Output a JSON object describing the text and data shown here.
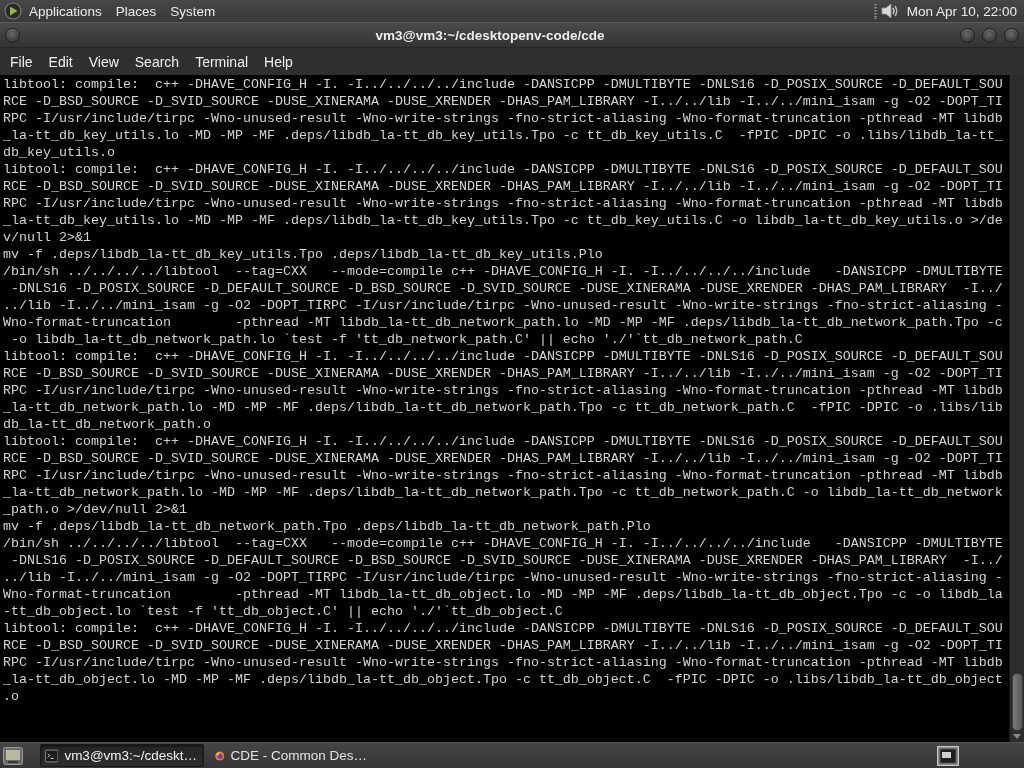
{
  "top_panel": {
    "menus": [
      "Applications",
      "Places",
      "System"
    ],
    "clock": "Mon Apr 10, 22:00"
  },
  "window": {
    "title": "vm3@vm3:~/cdesktopenv-code/cde",
    "menu": [
      "File",
      "Edit",
      "View",
      "Search",
      "Terminal",
      "Help"
    ]
  },
  "terminal": {
    "lines": [
      "libtool: compile:  c++ -DHAVE_CONFIG_H -I. -I../../../../include -DANSICPP -DMULTIBYTE -DNLS16 -D_POSIX_SOURCE -D_DEFAULT_SOU",
      "RCE -D_BSD_SOURCE -D_SVID_SOURCE -DUSE_XINERAMA -DUSE_XRENDER -DHAS_PAM_LIBRARY -I../../lib -I../../mini_isam -g -O2 -DOPT_TI",
      "RPC -I/usr/include/tirpc -Wno-unused-result -Wno-write-strings -fno-strict-aliasing -Wno-format-truncation -pthread -MT libdb",
      "_la-tt_db_key_utils.lo -MD -MP -MF .deps/libdb_la-tt_db_key_utils.Tpo -c tt_db_key_utils.C  -fPIC -DPIC -o .libs/libdb_la-tt_",
      "db_key_utils.o",
      "libtool: compile:  c++ -DHAVE_CONFIG_H -I. -I../../../../include -DANSICPP -DMULTIBYTE -DNLS16 -D_POSIX_SOURCE -D_DEFAULT_SOU",
      "RCE -D_BSD_SOURCE -D_SVID_SOURCE -DUSE_XINERAMA -DUSE_XRENDER -DHAS_PAM_LIBRARY -I../../lib -I../../mini_isam -g -O2 -DOPT_TI",
      "RPC -I/usr/include/tirpc -Wno-unused-result -Wno-write-strings -fno-strict-aliasing -Wno-format-truncation -pthread -MT libdb",
      "_la-tt_db_key_utils.lo -MD -MP -MF .deps/libdb_la-tt_db_key_utils.Tpo -c tt_db_key_utils.C -o libdb_la-tt_db_key_utils.o >/de",
      "v/null 2>&1",
      "mv -f .deps/libdb_la-tt_db_key_utils.Tpo .deps/libdb_la-tt_db_key_utils.Plo",
      "/bin/sh ../../../../libtool  --tag=CXX   --mode=compile c++ -DHAVE_CONFIG_H -I. -I../../../../include   -DANSICPP -DMULTIBYTE",
      " -DNLS16 -D_POSIX_SOURCE -D_DEFAULT_SOURCE -D_BSD_SOURCE -D_SVID_SOURCE -DUSE_XINERAMA -DUSE_XRENDER -DHAS_PAM_LIBRARY  -I../",
      "../lib -I../../mini_isam -g -O2 -DOPT_TIRPC -I/usr/include/tirpc -Wno-unused-result -Wno-write-strings -fno-strict-aliasing -",
      "Wno-format-truncation        -pthread -MT libdb_la-tt_db_network_path.lo -MD -MP -MF .deps/libdb_la-tt_db_network_path.Tpo -c",
      " -o libdb_la-tt_db_network_path.lo `test -f 'tt_db_network_path.C' || echo './'`tt_db_network_path.C",
      "libtool: compile:  c++ -DHAVE_CONFIG_H -I. -I../../../../include -DANSICPP -DMULTIBYTE -DNLS16 -D_POSIX_SOURCE -D_DEFAULT_SOU",
      "RCE -D_BSD_SOURCE -D_SVID_SOURCE -DUSE_XINERAMA -DUSE_XRENDER -DHAS_PAM_LIBRARY -I../../lib -I../../mini_isam -g -O2 -DOPT_TI",
      "RPC -I/usr/include/tirpc -Wno-unused-result -Wno-write-strings -fno-strict-aliasing -Wno-format-truncation -pthread -MT libdb",
      "_la-tt_db_network_path.lo -MD -MP -MF .deps/libdb_la-tt_db_network_path.Tpo -c tt_db_network_path.C  -fPIC -DPIC -o .libs/lib",
      "db_la-tt_db_network_path.o",
      "libtool: compile:  c++ -DHAVE_CONFIG_H -I. -I../../../../include -DANSICPP -DMULTIBYTE -DNLS16 -D_POSIX_SOURCE -D_DEFAULT_SOU",
      "RCE -D_BSD_SOURCE -D_SVID_SOURCE -DUSE_XINERAMA -DUSE_XRENDER -DHAS_PAM_LIBRARY -I../../lib -I../../mini_isam -g -O2 -DOPT_TI",
      "RPC -I/usr/include/tirpc -Wno-unused-result -Wno-write-strings -fno-strict-aliasing -Wno-format-truncation -pthread -MT libdb",
      "_la-tt_db_network_path.lo -MD -MP -MF .deps/libdb_la-tt_db_network_path.Tpo -c tt_db_network_path.C -o libdb_la-tt_db_network",
      "_path.o >/dev/null 2>&1",
      "mv -f .deps/libdb_la-tt_db_network_path.Tpo .deps/libdb_la-tt_db_network_path.Plo",
      "/bin/sh ../../../../libtool  --tag=CXX   --mode=compile c++ -DHAVE_CONFIG_H -I. -I../../../../include   -DANSICPP -DMULTIBYTE",
      " -DNLS16 -D_POSIX_SOURCE -D_DEFAULT_SOURCE -D_BSD_SOURCE -D_SVID_SOURCE -DUSE_XINERAMA -DUSE_XRENDER -DHAS_PAM_LIBRARY  -I../",
      "../lib -I../../mini_isam -g -O2 -DOPT_TIRPC -I/usr/include/tirpc -Wno-unused-result -Wno-write-strings -fno-strict-aliasing -",
      "Wno-format-truncation        -pthread -MT libdb_la-tt_db_object.lo -MD -MP -MF .deps/libdb_la-tt_db_object.Tpo -c -o libdb_la",
      "-tt_db_object.lo `test -f 'tt_db_object.C' || echo './'`tt_db_object.C",
      "libtool: compile:  c++ -DHAVE_CONFIG_H -I. -I../../../../include -DANSICPP -DMULTIBYTE -DNLS16 -D_POSIX_SOURCE -D_DEFAULT_SOU",
      "RCE -D_BSD_SOURCE -D_SVID_SOURCE -DUSE_XINERAMA -DUSE_XRENDER -DHAS_PAM_LIBRARY -I../../lib -I../../mini_isam -g -O2 -DOPT_TI",
      "RPC -I/usr/include/tirpc -Wno-unused-result -Wno-write-strings -fno-strict-aliasing -Wno-format-truncation -pthread -MT libdb",
      "_la-tt_db_object.lo -MD -MP -MF .deps/libdb_la-tt_db_object.Tpo -c tt_db_object.C  -fPIC -DPIC -o .libs/libdb_la-tt_db_object",
      ".o"
    ]
  },
  "taskbar": {
    "tasks": [
      {
        "kind": "terminal",
        "label": "vm3@vm3:~/cdeskt…",
        "selected": true
      },
      {
        "kind": "browser",
        "label": "CDE - Common Des…",
        "selected": false
      }
    ]
  }
}
